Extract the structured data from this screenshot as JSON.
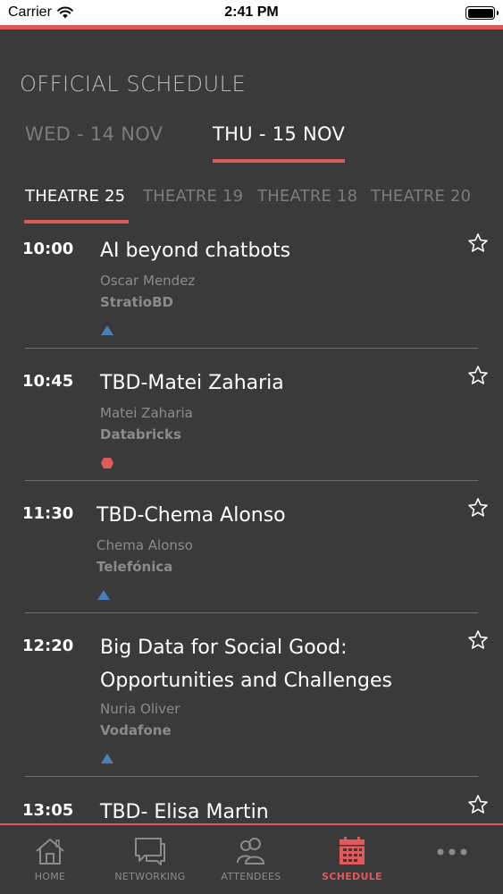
{
  "status_bar": {
    "carrier": "Carrier",
    "time": "2:41 PM"
  },
  "page_title": "OFFICIAL SCHEDULE",
  "days": [
    {
      "label": "WED - 14 NOV",
      "active": false
    },
    {
      "label": "THU - 15 NOV",
      "active": true
    }
  ],
  "theatres": [
    {
      "label": "THEATRE 25",
      "active": true
    },
    {
      "label": "THEATRE 19",
      "active": false
    },
    {
      "label": "THEATRE 18",
      "active": false
    },
    {
      "label": "THEATRE 20",
      "active": false
    }
  ],
  "sessions": [
    {
      "time": "10:00",
      "title": "AI beyond chatbots",
      "speaker": "Oscar Mendez",
      "company": "StratioBD",
      "marker": "triangle"
    },
    {
      "time": "10:45",
      "title": "TBD-Matei Zaharia",
      "speaker": "Matei Zaharia",
      "company": "Databricks",
      "marker": "hexagon"
    },
    {
      "time": "11:30",
      "title": "TBD-Chema Alonso",
      "speaker": "Chema Alonso",
      "company": "Telefónica",
      "marker": "triangle"
    },
    {
      "time": "12:20",
      "title": "Big Data for Social Good: Opportunities and Challenges",
      "speaker": "Nuria Oliver",
      "company": "Vodafone",
      "marker": "triangle"
    },
    {
      "time": "13:05",
      "title": "TBD- Elisa Martin",
      "speaker": "",
      "company": "",
      "marker": ""
    }
  ],
  "tab_bar": [
    {
      "label": "HOME",
      "icon": "home-icon",
      "active": false
    },
    {
      "label": "NETWORKING",
      "icon": "chat-icon",
      "active": false
    },
    {
      "label": "ATTENDEES",
      "icon": "people-icon",
      "active": false
    },
    {
      "label": "SCHEDULE",
      "icon": "calendar-icon",
      "active": true
    },
    {
      "label": "",
      "icon": "more-icon",
      "active": false
    }
  ],
  "colors": {
    "background": "#3b3a3b",
    "accent": "#e05a5b",
    "triangle_marker": "#4a7fb5",
    "hexagon_marker": "#e05a5b"
  }
}
